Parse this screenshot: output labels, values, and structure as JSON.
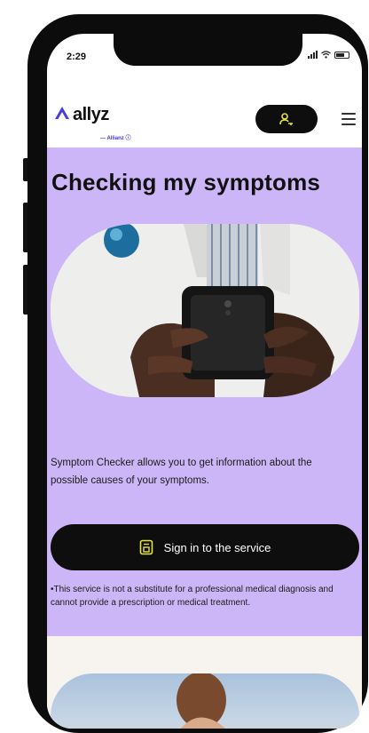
{
  "status_bar": {
    "time": "2:29"
  },
  "header": {
    "logo_text": "allyz",
    "logo_sub": "— Allianz ⓘ",
    "account_icon": "user-key-icon",
    "menu_icon": "hamburger-menu-icon"
  },
  "hero": {
    "title": "Checking my symptoms",
    "description": "Symptom Checker allows you to get information about the possible causes of your symptoms.",
    "signin_label": "Sign in to the service",
    "signin_icon": "login-door-icon",
    "disclaimer": "•This service is not a substitute for a professional medical diagnosis and cannot provide a prescription or medical treatment."
  },
  "colors": {
    "accent": "#4a3fd6",
    "hero_bg": "#cdb6f7",
    "button_bg": "#0e0e0e",
    "icon_yellow": "#e7e53c"
  }
}
